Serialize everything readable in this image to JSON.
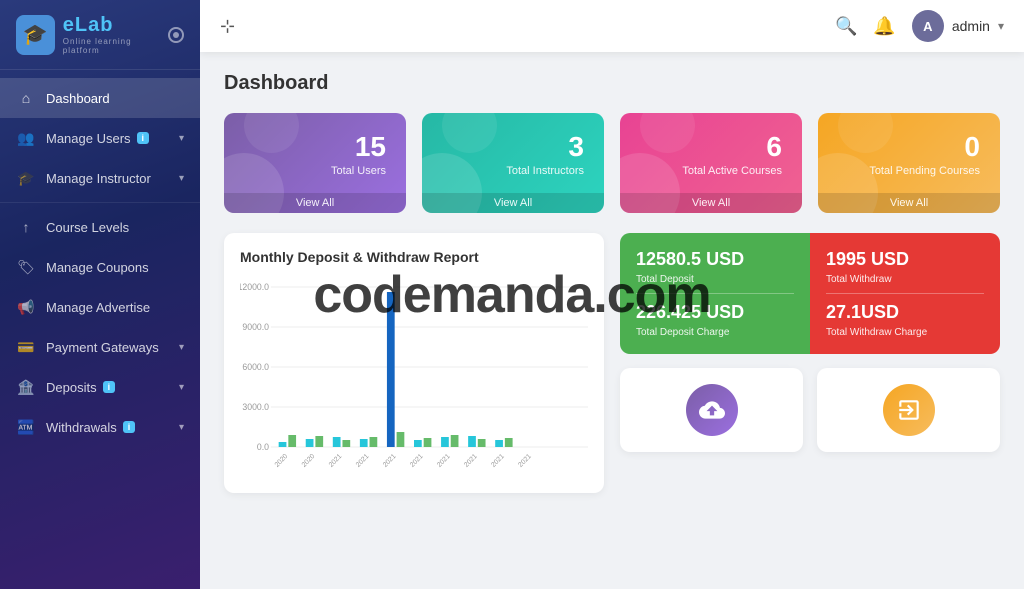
{
  "sidebar": {
    "logo": {
      "text_e": "e",
      "text_lab": "Lab",
      "sub": "Online learning platform"
    },
    "nav_items": [
      {
        "id": "dashboard",
        "label": "Dashboard",
        "icon": "⌂",
        "active": true
      },
      {
        "id": "manage-users",
        "label": "Manage Users",
        "icon": "👥",
        "badge": "i",
        "has_chevron": true
      },
      {
        "id": "manage-instructor",
        "label": "Manage Instructor",
        "icon": "🎓",
        "has_chevron": true
      },
      {
        "id": "course-levels",
        "label": "Course Levels",
        "icon": "↑"
      },
      {
        "id": "manage-coupons",
        "label": "Manage Coupons",
        "icon": "🏷"
      },
      {
        "id": "manage-advertise",
        "label": "Manage Advertise",
        "icon": "📢"
      },
      {
        "id": "payment-gateways",
        "label": "Payment Gateways",
        "icon": "💳",
        "has_chevron": true
      },
      {
        "id": "deposits",
        "label": "Deposits",
        "icon": "🏦",
        "badge": "i",
        "has_chevron": true
      },
      {
        "id": "withdrawals",
        "label": "Withdrawals",
        "icon": "🏧",
        "badge": "i",
        "has_chevron": true
      }
    ]
  },
  "topbar": {
    "expand_icon": "⊹",
    "search_icon": "🔍",
    "bell_icon": "🔔",
    "user": {
      "name": "admin",
      "avatar_text": "A"
    }
  },
  "dashboard": {
    "title": "Dashboard",
    "stats": [
      {
        "number": "15",
        "label": "Total Users",
        "view_all": "View All",
        "color": "purple"
      },
      {
        "number": "3",
        "label": "Total Instructors",
        "view_all": "View All",
        "color": "teal"
      },
      {
        "number": "6",
        "label": "Total Active Courses",
        "view_all": "View All",
        "color": "pink"
      },
      {
        "number": "0",
        "label": "Total Pending Courses",
        "view_all": "View All",
        "color": "orange"
      }
    ],
    "chart": {
      "title": "Monthly Deposit & Withdraw Report",
      "y_labels": [
        "12000.0",
        "9000.0",
        "6000.0",
        "3000.0",
        "0.0"
      ],
      "x_labels": [
        "2020",
        "2020",
        "2021",
        "2021",
        "2021",
        "2021",
        "2021",
        "2021",
        "2021",
        "2021"
      ]
    },
    "finance": [
      {
        "amount": "12580.5 USD",
        "label": "Total Deposit",
        "color": "green"
      },
      {
        "amount": "1995 USD",
        "label": "Total Withdraw",
        "color": "red"
      },
      {
        "amount": "226.425 USD",
        "label": "Total Deposit Charge",
        "color": "green"
      },
      {
        "amount": "27.1USD",
        "label": "Total Withdraw Charge",
        "color": "red"
      }
    ],
    "icons": [
      {
        "icon": "☁",
        "color": "purple-grad"
      },
      {
        "icon": "⎋",
        "color": "orange-grad"
      }
    ]
  },
  "watermark": "codemanda.com"
}
